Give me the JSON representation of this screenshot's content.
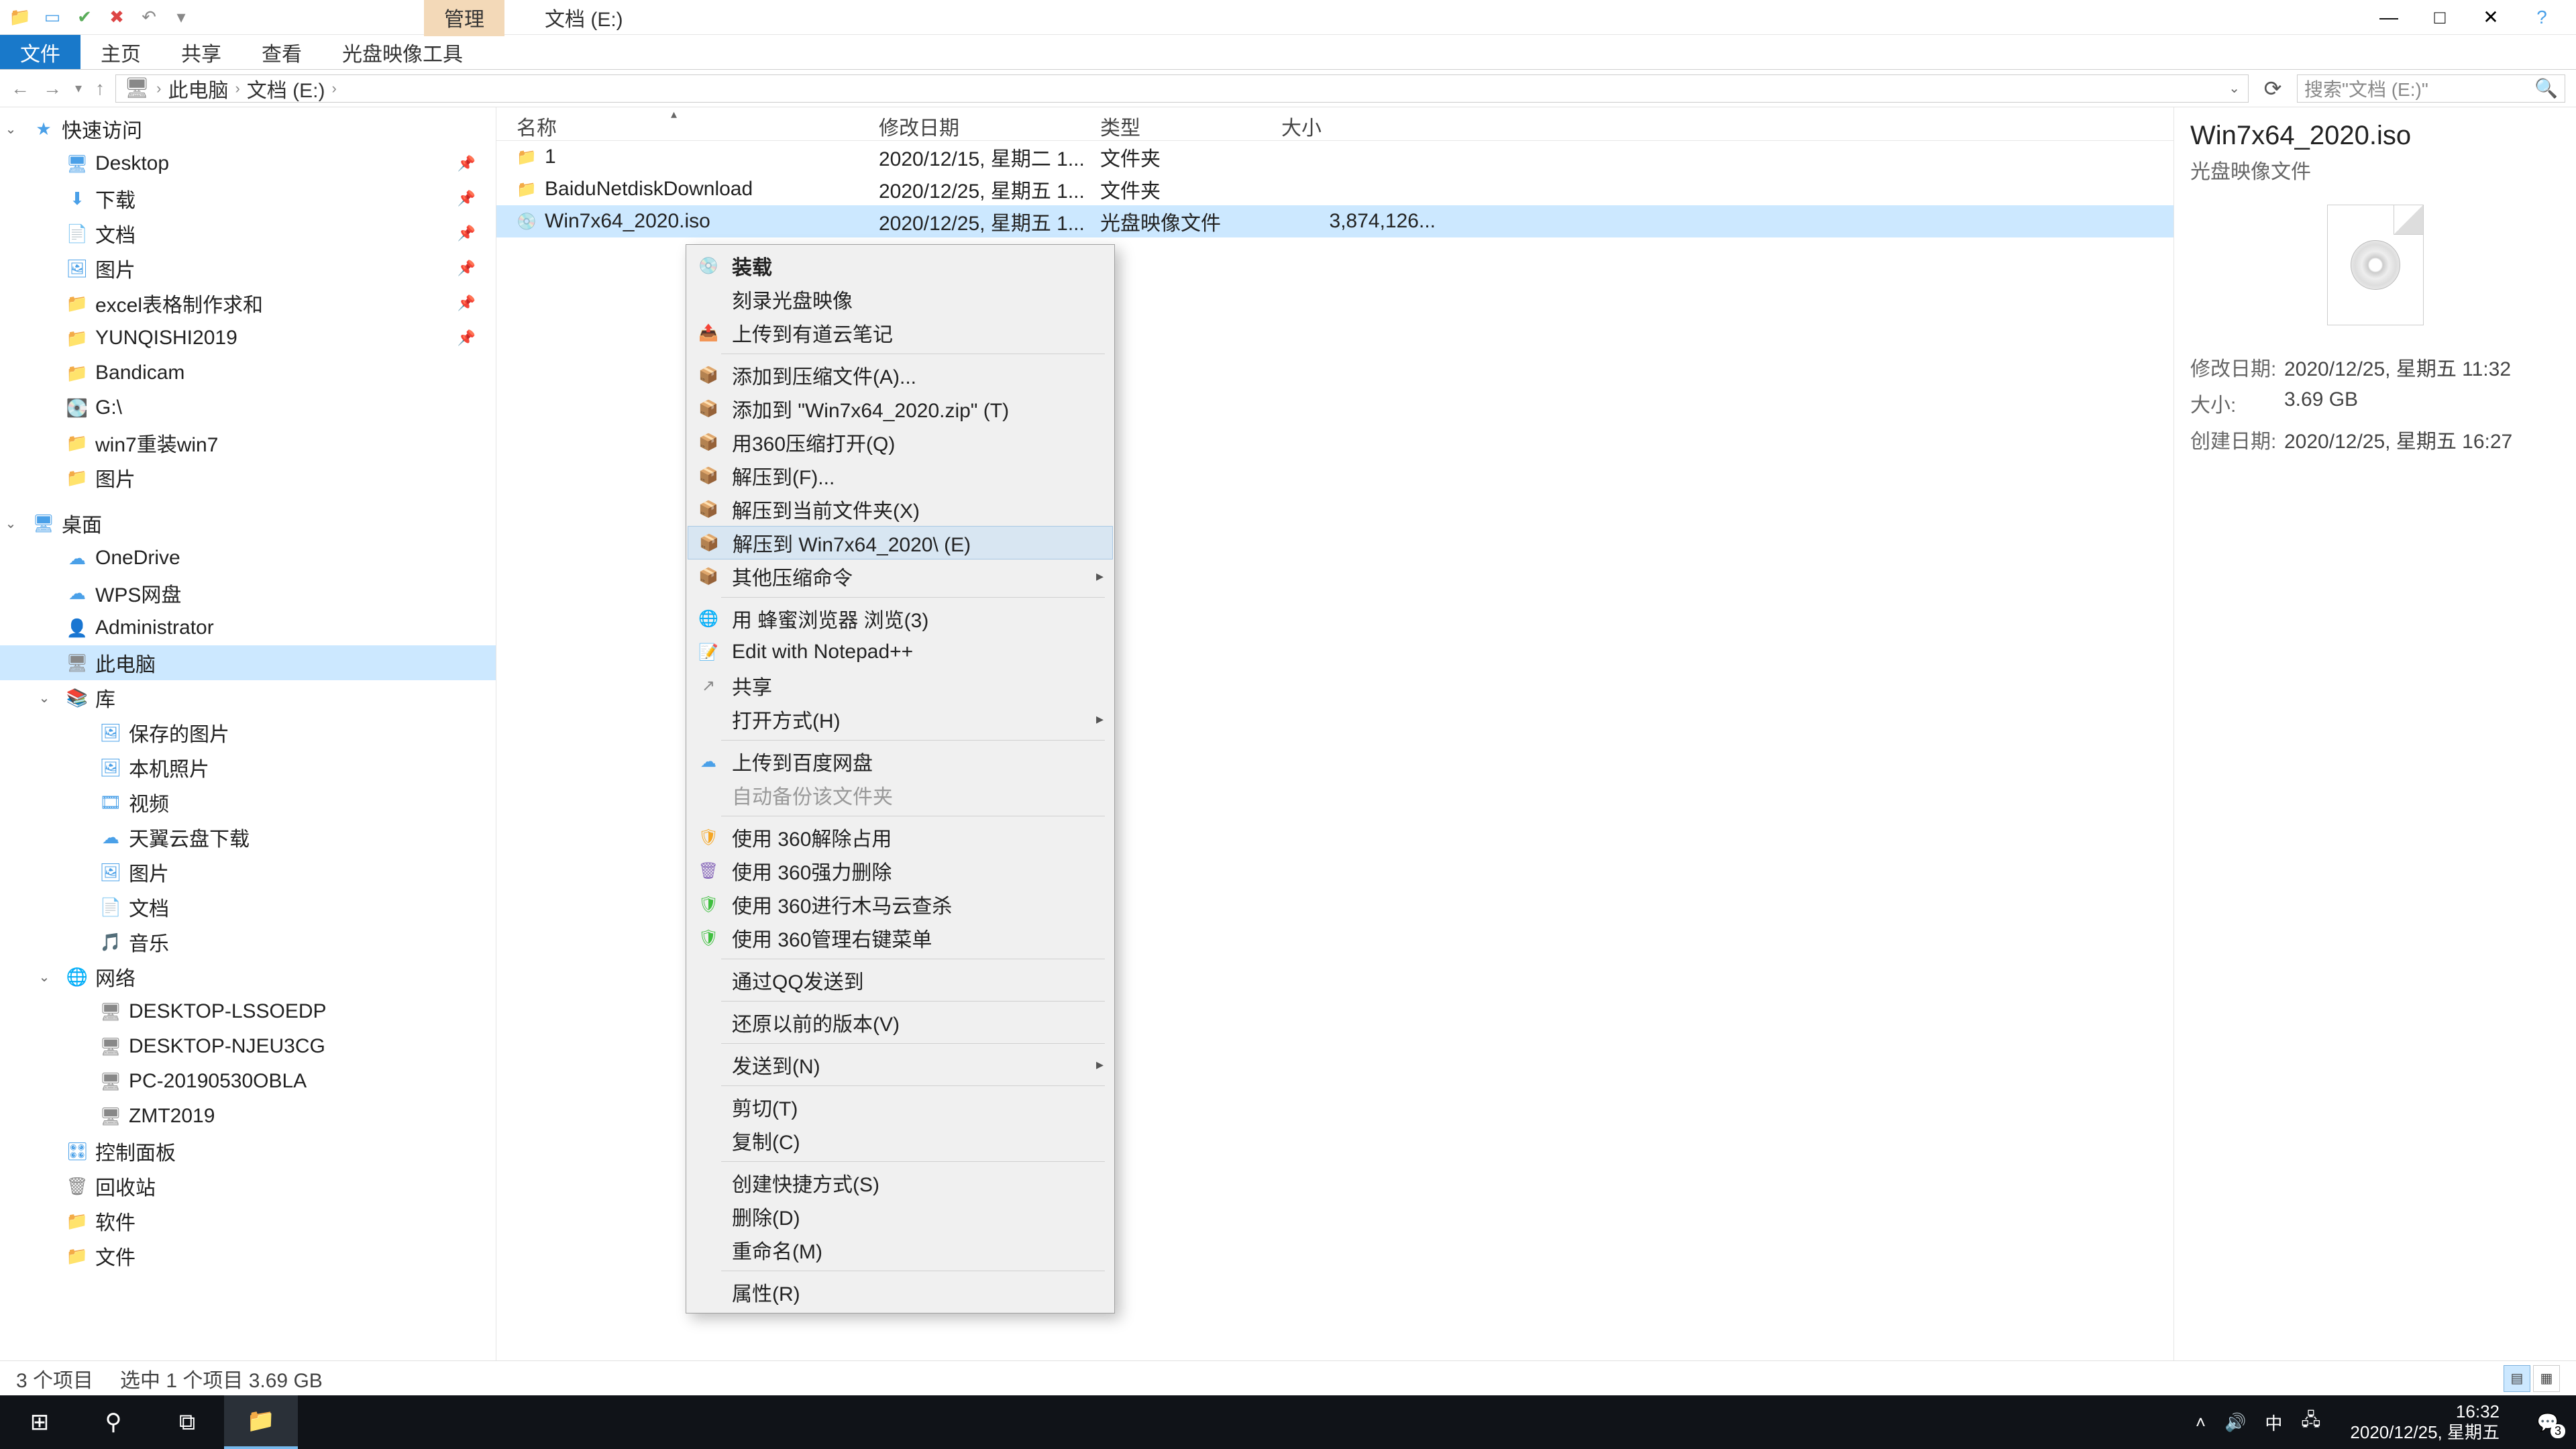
{
  "window": {
    "contextual_tab": "管理",
    "title": "文档 (E:)",
    "minimize": "—",
    "maximize": "□",
    "close": "✕",
    "help": "?"
  },
  "ribbon": {
    "tabs": [
      "文件",
      "主页",
      "共享",
      "查看",
      "光盘映像工具"
    ]
  },
  "address": {
    "back": "←",
    "forward": "→",
    "up": "↑",
    "crumbs": [
      "此电脑",
      "文档 (E:)"
    ],
    "search_placeholder": "搜索\"文档 (E:)\"",
    "refresh": "⟳"
  },
  "nav": {
    "quick_access": "快速访问",
    "items_qa": [
      {
        "icon": "🖥",
        "label": "Desktop",
        "pin": true,
        "cls": "c-blue"
      },
      {
        "icon": "⬇",
        "label": "下载",
        "pin": true,
        "cls": "c-blue"
      },
      {
        "icon": "📄",
        "label": "文档",
        "pin": true,
        "cls": "c-blue"
      },
      {
        "icon": "🖼",
        "label": "图片",
        "pin": true,
        "cls": "c-blue"
      },
      {
        "icon": "📁",
        "label": "excel表格制作求和",
        "pin": true,
        "cls": "c-yellow"
      },
      {
        "icon": "📁",
        "label": "YUNQISHI2019",
        "pin": true,
        "cls": "c-yellow"
      },
      {
        "icon": "📁",
        "label": "Bandicam",
        "cls": "c-yellow"
      },
      {
        "icon": "💽",
        "label": "G:\\",
        "cls": "c-gray"
      },
      {
        "icon": "📁",
        "label": "win7重装win7",
        "cls": "c-yellow"
      },
      {
        "icon": "📁",
        "label": "图片",
        "cls": "c-yellow"
      }
    ],
    "desktop": "桌面",
    "items_dt": [
      {
        "icon": "☁",
        "label": "OneDrive",
        "cls": "c-blue"
      },
      {
        "icon": "☁",
        "label": "WPS网盘",
        "cls": "c-blue"
      },
      {
        "icon": "👤",
        "label": "Administrator",
        "cls": "c-gray"
      },
      {
        "icon": "🖥",
        "label": "此电脑",
        "cls": "c-gray",
        "sel": true
      },
      {
        "icon": "📚",
        "label": "库",
        "cls": "c-blue",
        "exp": true
      }
    ],
    "items_lib": [
      {
        "icon": "🖼",
        "label": "保存的图片",
        "cls": "c-blue"
      },
      {
        "icon": "🖼",
        "label": "本机照片",
        "cls": "c-blue"
      },
      {
        "icon": "🎞",
        "label": "视频",
        "cls": "c-blue"
      },
      {
        "icon": "☁",
        "label": "天翼云盘下载",
        "cls": "c-blue"
      },
      {
        "icon": "🖼",
        "label": "图片",
        "cls": "c-blue"
      },
      {
        "icon": "📄",
        "label": "文档",
        "cls": "c-blue"
      },
      {
        "icon": "🎵",
        "label": "音乐",
        "cls": "c-blue"
      }
    ],
    "network": "网络",
    "items_net": [
      {
        "icon": "🖥",
        "label": "DESKTOP-LSSOEDP",
        "cls": "c-gray"
      },
      {
        "icon": "🖥",
        "label": "DESKTOP-NJEU3CG",
        "cls": "c-gray"
      },
      {
        "icon": "🖥",
        "label": "PC-20190530OBLA",
        "cls": "c-gray"
      },
      {
        "icon": "🖥",
        "label": "ZMT2019",
        "cls": "c-gray"
      }
    ],
    "items_tail": [
      {
        "icon": "🎛",
        "label": "控制面板",
        "cls": "c-blue"
      },
      {
        "icon": "🗑",
        "label": "回收站",
        "cls": "c-gray"
      },
      {
        "icon": "📁",
        "label": "软件",
        "cls": "c-yellow"
      },
      {
        "icon": "📁",
        "label": "文件",
        "cls": "c-yellow"
      }
    ]
  },
  "files": {
    "headers": {
      "name": "名称",
      "date": "修改日期",
      "type": "类型",
      "size": "大小"
    },
    "rows": [
      {
        "icon": "📁",
        "name": "1",
        "date": "2020/12/15, 星期二 1...",
        "type": "文件夹",
        "size": "",
        "cls": "c-yellow"
      },
      {
        "icon": "📁",
        "name": "BaiduNetdiskDownload",
        "date": "2020/12/25, 星期五 1...",
        "type": "文件夹",
        "size": "",
        "cls": "c-yellow"
      },
      {
        "icon": "💿",
        "name": "Win7x64_2020.iso",
        "date": "2020/12/25, 星期五 1...",
        "type": "光盘映像文件",
        "size": "3,874,126...",
        "cls": "c-gray",
        "selected": true
      }
    ]
  },
  "ctx": [
    {
      "icon": "💿",
      "label": "装载",
      "bold": true,
      "cls": "c-gray"
    },
    {
      "icon": "",
      "label": "刻录光盘映像"
    },
    {
      "icon": "📤",
      "label": "上传到有道云笔记",
      "cls": "c-blue"
    },
    {
      "sep": true
    },
    {
      "icon": "📦",
      "label": "添加到压缩文件(A)...",
      "cls": "c-orange"
    },
    {
      "icon": "📦",
      "label": "添加到 \"Win7x64_2020.zip\" (T)",
      "cls": "c-orange"
    },
    {
      "icon": "📦",
      "label": "用360压缩打开(Q)",
      "cls": "c-orange"
    },
    {
      "icon": "📦",
      "label": "解压到(F)...",
      "cls": "c-orange"
    },
    {
      "icon": "📦",
      "label": "解压到当前文件夹(X)",
      "cls": "c-orange"
    },
    {
      "icon": "📦",
      "label": "解压到 Win7x64_2020\\ (E)",
      "cls": "c-orange",
      "hover": true
    },
    {
      "icon": "📦",
      "label": "其他压缩命令",
      "cls": "c-orange",
      "arrow": true
    },
    {
      "sep": true
    },
    {
      "icon": "🌐",
      "label": "用 蜂蜜浏览器 浏览(3)",
      "cls": "c-green"
    },
    {
      "icon": "📝",
      "label": "Edit with Notepad++",
      "cls": "c-green"
    },
    {
      "icon": "↗",
      "label": "共享",
      "cls": "c-gray"
    },
    {
      "icon": "",
      "label": "打开方式(H)",
      "arrow": true
    },
    {
      "sep": true
    },
    {
      "icon": "☁",
      "label": "上传到百度网盘",
      "cls": "c-blue"
    },
    {
      "icon": "",
      "label": "自动备份该文件夹",
      "disabled": true
    },
    {
      "sep": true
    },
    {
      "icon": "🛡",
      "label": "使用 360解除占用",
      "cls": "c-360"
    },
    {
      "icon": "🗑",
      "label": "使用 360强力删除",
      "cls": "c-purple"
    },
    {
      "icon": "🛡",
      "label": "使用 360进行木马云查杀",
      "cls": "c-360g"
    },
    {
      "icon": "🛡",
      "label": "使用 360管理右键菜单",
      "cls": "c-360g"
    },
    {
      "sep": true
    },
    {
      "icon": "",
      "label": "通过QQ发送到"
    },
    {
      "sep": true
    },
    {
      "icon": "",
      "label": "还原以前的版本(V)"
    },
    {
      "sep": true
    },
    {
      "icon": "",
      "label": "发送到(N)",
      "arrow": true
    },
    {
      "sep": true
    },
    {
      "icon": "",
      "label": "剪切(T)"
    },
    {
      "icon": "",
      "label": "复制(C)"
    },
    {
      "sep": true
    },
    {
      "icon": "",
      "label": "创建快捷方式(S)"
    },
    {
      "icon": "",
      "label": "删除(D)"
    },
    {
      "icon": "",
      "label": "重命名(M)"
    },
    {
      "sep": true
    },
    {
      "icon": "",
      "label": "属性(R)"
    }
  ],
  "details": {
    "title": "Win7x64_2020.iso",
    "subtitle": "光盘映像文件",
    "meta": [
      {
        "k": "修改日期:",
        "v": "2020/12/25, 星期五 11:32"
      },
      {
        "k": "大小:",
        "v": "3.69 GB"
      },
      {
        "k": "创建日期:",
        "v": "2020/12/25, 星期五 16:27"
      }
    ]
  },
  "status": {
    "count": "3 个项目",
    "selection": "选中 1 个项目  3.69 GB"
  },
  "taskbar": {
    "time": "16:32",
    "date": "2020/12/25, 星期五",
    "ime": "中",
    "notif_badge": "3"
  }
}
